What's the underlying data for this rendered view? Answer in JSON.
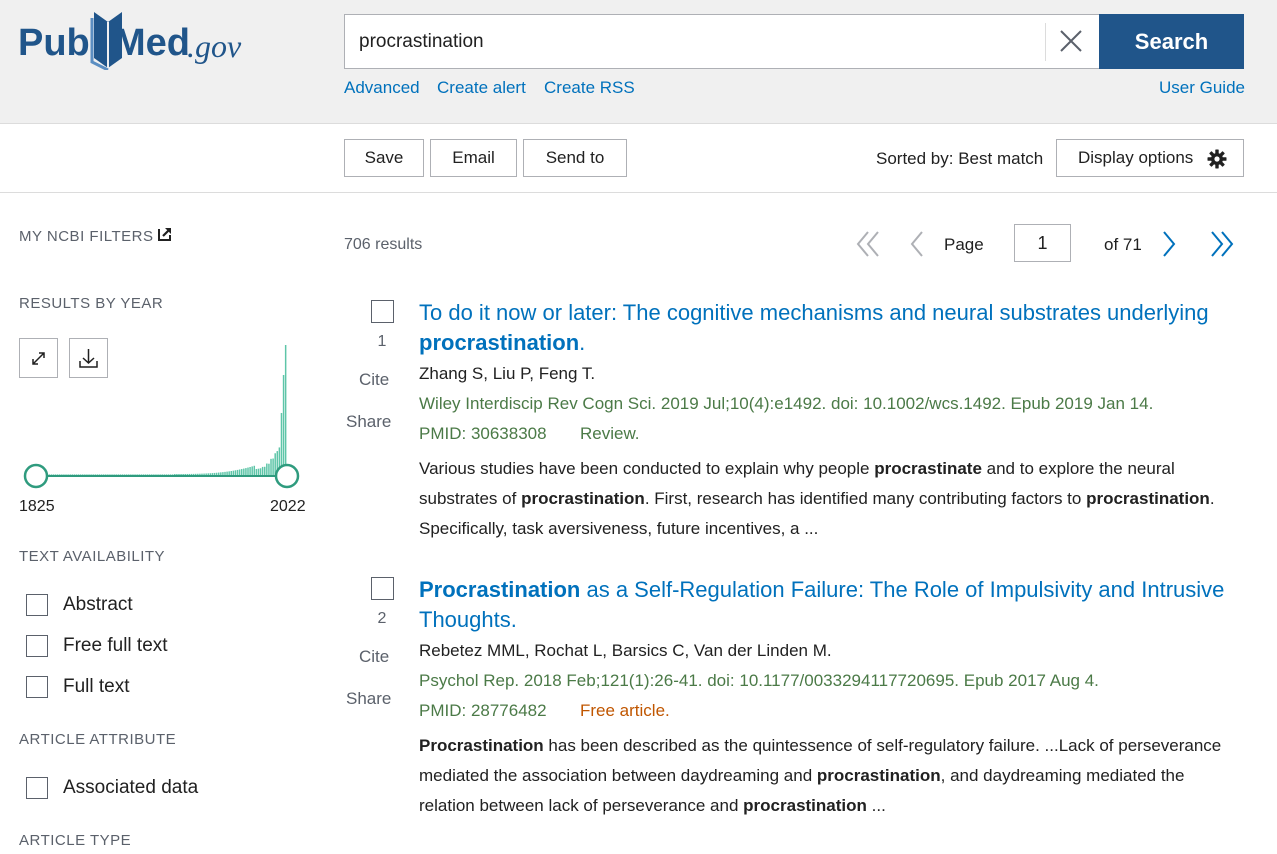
{
  "header": {
    "logo": {
      "pub": "Pub",
      "med": "Med",
      "gov": ".gov"
    },
    "search": {
      "value": "procrastination",
      "button_label": "Search"
    },
    "links": {
      "advanced": "Advanced",
      "create_alert": "Create alert",
      "create_rss": "Create RSS",
      "user_guide": "User Guide"
    }
  },
  "toolbar": {
    "save": "Save",
    "email": "Email",
    "send_to": "Send to",
    "sorted_by": "Sorted by: Best match",
    "display_options": "Display options"
  },
  "sidebar": {
    "my_ncbi_filters": "MY NCBI FILTERS",
    "results_by_year": "RESULTS BY YEAR",
    "year_start": "1825",
    "year_end": "2022",
    "text_availability": "TEXT AVAILABILITY",
    "text_filters": [
      "Abstract",
      "Free full text",
      "Full text"
    ],
    "article_attribute": "ARTICLE ATTRIBUTE",
    "attribute_filters": [
      "Associated data"
    ],
    "article_type": "ARTICLE TYPE"
  },
  "results_header": {
    "count": "706 results",
    "page_label": "Page",
    "page_value": "1",
    "page_of": "of 71"
  },
  "results": [
    {
      "number": "1",
      "title_parts": [
        {
          "text": "To do it now or later: The cognitive mechanisms and neural substrates underlying ",
          "bold": false
        },
        {
          "text": "procrastination",
          "bold": true
        },
        {
          "text": ".",
          "bold": false
        }
      ],
      "authors": "Zhang S, Liu P, Feng T.",
      "citation": "Wiley Interdiscip Rev Cogn Sci. 2019 Jul;10(4):e1492. doi: 10.1002/wcs.1492. Epub 2019 Jan 14.",
      "pmid": "PMID: 30638308",
      "tag": "Review.",
      "snippet_parts": [
        {
          "text": "Various studies have been conducted to explain why people ",
          "bold": false
        },
        {
          "text": "procrastinate",
          "bold": true
        },
        {
          "text": " and to explore the neural substrates of ",
          "bold": false
        },
        {
          "text": "procrastination",
          "bold": true
        },
        {
          "text": ". First, research has identified many contributing factors to ",
          "bold": false
        },
        {
          "text": "procrastination",
          "bold": true
        },
        {
          "text": ". Specifically, task aversiveness, future incentives, a ...",
          "bold": false
        }
      ],
      "cite": "Cite",
      "share": "Share"
    },
    {
      "number": "2",
      "title_parts": [
        {
          "text": "Procrastination",
          "bold": true
        },
        {
          "text": " as a Self-Regulation Failure: The Role of Impulsivity and Intrusive Thoughts.",
          "bold": false
        }
      ],
      "authors": "Rebetez MML, Rochat L, Barsics C, Van der Linden M.",
      "citation": "Psychol Rep. 2018 Feb;121(1):26-41. doi: 10.1177/0033294117720695. Epub 2017 Aug 4.",
      "pmid": "PMID: 28776482",
      "tag": "Free article.",
      "snippet_parts": [
        {
          "text": "Procrastination",
          "bold": true
        },
        {
          "text": " has been described as the quintessence of self-regulatory failure. ...Lack of perseverance mediated the association between daydreaming and ",
          "bold": false
        },
        {
          "text": "procrastination",
          "bold": true
        },
        {
          "text": ", and daydreaming mediated the relation between lack of perseverance and ",
          "bold": false
        },
        {
          "text": "procrastination",
          "bold": true
        },
        {
          "text": " ...",
          "bold": false
        }
      ],
      "cite": "Cite",
      "share": "Share"
    }
  ],
  "colors": {
    "brand": "#20558a",
    "link": "#0071bc",
    "citation_green": "#4b7a47",
    "free_article": "#c05600",
    "chart_teal": "#5ec5a8",
    "slider": "#2f9b7e"
  }
}
